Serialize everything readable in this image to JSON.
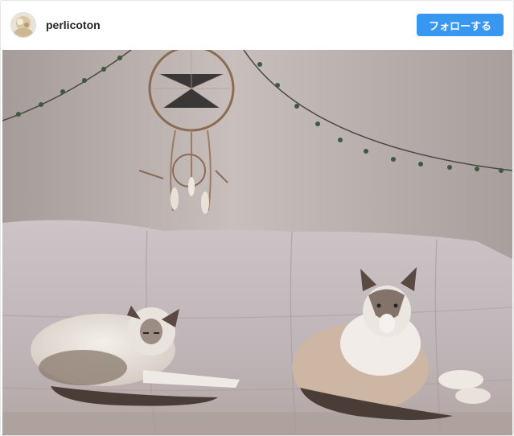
{
  "post": {
    "username": "perlicoton",
    "follow_label": "フォローする"
  },
  "colors": {
    "follow_button": "#3897f0",
    "username_text": "#262626",
    "wall": "#bdb3b1",
    "blanket": "#c7bdc0"
  },
  "icons": {
    "avatar": "user-avatar"
  },
  "photo": {
    "subject": "two siamese cats on a bed",
    "decorations": [
      "dreamcatcher",
      "string-lights"
    ]
  }
}
